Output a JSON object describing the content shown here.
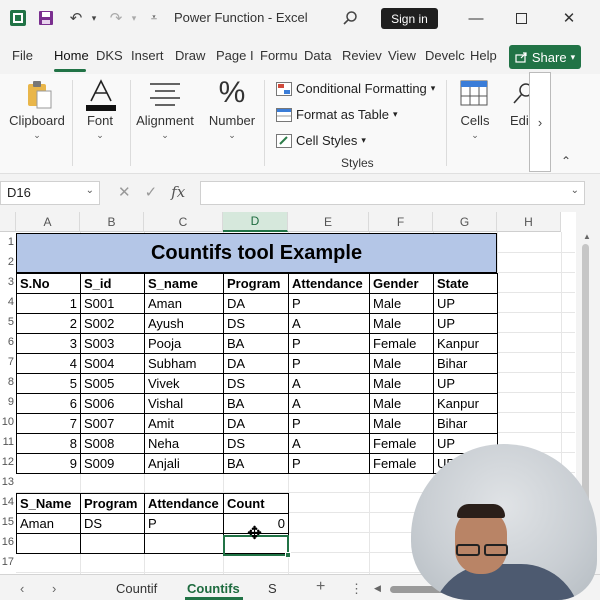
{
  "window": {
    "title": "Power Function  -  Excel",
    "sign_in": "Sign in",
    "share": "Share"
  },
  "ribbon_tabs": [
    "File",
    "Home",
    "DKS",
    "Insert",
    "Draw",
    "Page I",
    "Formu",
    "Data",
    "Reviev",
    "View",
    "Develc",
    "Help"
  ],
  "ribbon": {
    "clipboard": "Clipboard",
    "font": "Font",
    "alignment": "Alignment",
    "number": "Number",
    "number_glyph": "%",
    "conditional_formatting": "Conditional Formatting",
    "format_as_table": "Format as Table",
    "cell_styles": "Cell Styles",
    "styles_group": "Styles",
    "cells": "Cells",
    "editing": "Edi"
  },
  "formula_bar": {
    "name_box": "D16",
    "fx": "fx",
    "content": ""
  },
  "columns": [
    "A",
    "B",
    "C",
    "D",
    "E",
    "F",
    "G",
    "H"
  ],
  "rows": [
    "1",
    "2",
    "3",
    "4",
    "5",
    "6",
    "7",
    "8",
    "9",
    "10",
    "11",
    "12",
    "13",
    "14",
    "15",
    "16",
    "17"
  ],
  "sheet_title": "Countifs  tool Example",
  "table": {
    "headers": [
      "S.No",
      "S_id",
      "S_name",
      "Program",
      "Attendance",
      "Gender",
      "State"
    ],
    "rows": [
      [
        "1",
        "S001",
        "Aman",
        "DA",
        "P",
        "Male",
        "UP"
      ],
      [
        "2",
        "S002",
        "Ayush",
        "DS",
        "A",
        "Male",
        "UP"
      ],
      [
        "3",
        "S003",
        "Pooja",
        "BA",
        "P",
        "Female",
        "Kanpur"
      ],
      [
        "4",
        "S004",
        "Subham",
        "DA",
        "P",
        "Male",
        "Bihar"
      ],
      [
        "5",
        "S005",
        "Vivek",
        "DS",
        "A",
        "Male",
        "UP"
      ],
      [
        "6",
        "S006",
        "Vishal",
        "BA",
        "A",
        "Male",
        "Kanpur"
      ],
      [
        "7",
        "S007",
        "Amit",
        "DA",
        "P",
        "Male",
        "Bihar"
      ],
      [
        "8",
        "S008",
        "Neha",
        "DS",
        "A",
        "Female",
        "UP"
      ],
      [
        "9",
        "S009",
        "Anjali",
        "BA",
        "P",
        "Female",
        "UP"
      ]
    ]
  },
  "criteria": {
    "headers": [
      "S_Name",
      "Program",
      "Attendance",
      "Count"
    ],
    "row": [
      "Aman",
      "DS",
      "P",
      "0"
    ]
  },
  "sheet_tabs": [
    "Countif",
    "Countifs",
    "S"
  ],
  "active_sheet": "Countifs",
  "colors": {
    "accent": "#217346",
    "title_fill": "#b4c6e7"
  }
}
